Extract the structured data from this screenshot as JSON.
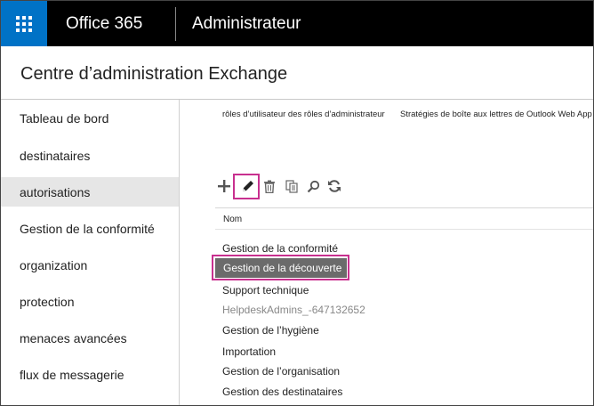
{
  "topbar": {
    "brand": "Office 365",
    "title": "Administrateur"
  },
  "page": {
    "title": "Centre d’administration Exchange"
  },
  "sidebar": {
    "items": [
      {
        "label": "Tableau de bord"
      },
      {
        "label": "destinataires"
      },
      {
        "label": "autorisations",
        "active": true
      },
      {
        "label": "Gestion de la conformité"
      },
      {
        "label": "organization"
      },
      {
        "label": "protection"
      },
      {
        "label": "menaces avancées"
      },
      {
        "label": "flux de messagerie"
      }
    ]
  },
  "tabs": {
    "tab1": "rôles d’utilisateur des rôles d’administrateur",
    "tab2": "Stratégies de boîte aux lettres de Outlook Web App"
  },
  "toolbar": {
    "icons": [
      "plus-icon",
      "pencil-icon",
      "trash-icon",
      "copy-icon",
      "search-icon",
      "refresh-icon"
    ]
  },
  "table": {
    "column_header": "Nom",
    "rows": [
      {
        "label": "Gestion de la conformité"
      },
      {
        "label": "Gestion de la découverte",
        "selected": true
      },
      {
        "label": "Support technique"
      },
      {
        "label": "HelpdeskAdmins_-647132652",
        "muted": true
      },
      {
        "label": "Gestion de l’hygiène"
      },
      {
        "label": "Importation"
      },
      {
        "label": "Gestion de l’organisation"
      },
      {
        "label": "Gestion des destinataires"
      }
    ]
  },
  "colors": {
    "accent_blue": "#0072c6",
    "highlight_magenta": "#c8308f",
    "selected_row": "#6b6b6b"
  }
}
